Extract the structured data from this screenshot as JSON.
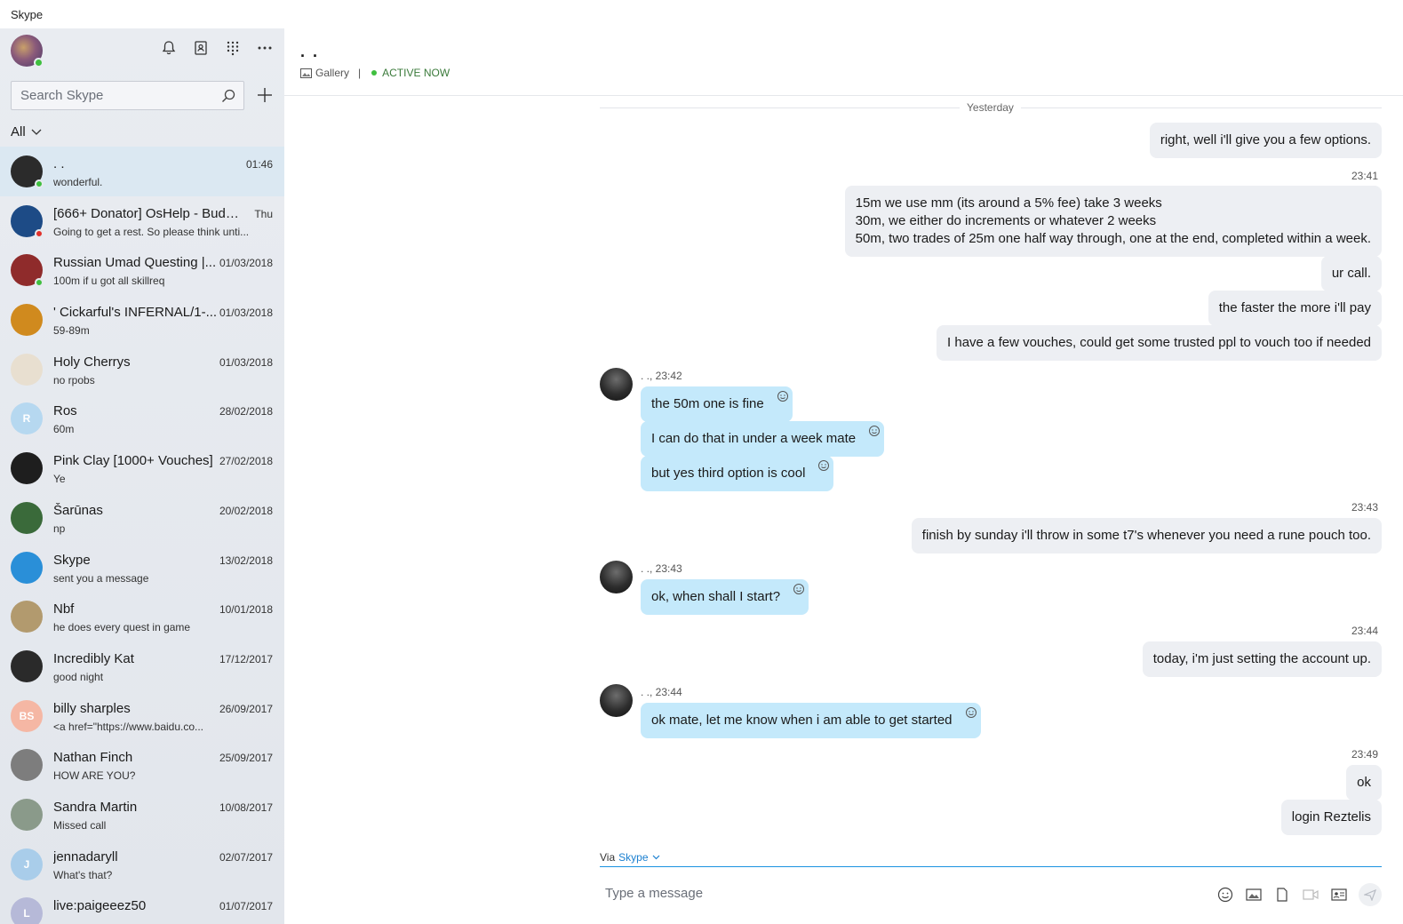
{
  "window": {
    "title": "Skype"
  },
  "sidebar": {
    "search_placeholder": "Search Skype",
    "filter_label": "All",
    "conversations": [
      {
        "name": ". .",
        "time": "01:46",
        "preview": "wonderful.",
        "avatar_color": "#2b2b2b",
        "initials": "",
        "presence": "#3fbf3f"
      },
      {
        "name": "[666+ Donator] OsHelp - Budd...",
        "time": "Thu",
        "preview": "Going to get a rest. So please think unti...",
        "avatar_color": "#1d4b86",
        "initials": "",
        "presence": "#e0312b"
      },
      {
        "name": "Russian Umad Questing |...",
        "time": "01/03/2018",
        "preview": "100m if u got all skillreq",
        "avatar_color": "#8f2b2b",
        "initials": "",
        "presence": "#3fbf3f"
      },
      {
        "name": "' Cickarful's INFERNAL/1-...",
        "time": "01/03/2018",
        "preview": "59-89m",
        "avatar_color": "#d08a1e",
        "initials": "",
        "presence": ""
      },
      {
        "name": "Holy Cherrys",
        "time": "01/03/2018",
        "preview": "no rpobs",
        "avatar_color": "#e8dfd0",
        "initials": "",
        "presence": ""
      },
      {
        "name": "Ros",
        "time": "28/02/2018",
        "preview": "60m",
        "avatar_color": "#b6d8f0",
        "initials": "R",
        "presence": ""
      },
      {
        "name": "Pink Clay [1000+ Vouches]",
        "time": "27/02/2018",
        "preview": "Ye",
        "avatar_color": "#1e1e1e",
        "initials": "",
        "presence": ""
      },
      {
        "name": "Šarūnas",
        "time": "20/02/2018",
        "preview": "np",
        "avatar_color": "#3a6a3a",
        "initials": "",
        "presence": ""
      },
      {
        "name": "Skype",
        "time": "13/02/2018",
        "preview": "sent you a message",
        "avatar_color": "#2a8fd8",
        "initials": "",
        "presence": ""
      },
      {
        "name": "Nbf",
        "time": "10/01/2018",
        "preview": "he does every quest in game",
        "avatar_color": "#b29a6e",
        "initials": "",
        "presence": ""
      },
      {
        "name": "Incredibly Kat",
        "time": "17/12/2017",
        "preview": "good night",
        "avatar_color": "#2a2a2a",
        "initials": "",
        "presence": ""
      },
      {
        "name": "billy sharples",
        "time": "26/09/2017",
        "preview": "<a href=\"https://www.baidu.co...",
        "avatar_color": "#f5b7a4",
        "initials": "BS",
        "presence": ""
      },
      {
        "name": "Nathan Finch",
        "time": "25/09/2017",
        "preview": "HOW ARE YOU?",
        "avatar_color": "#7d7d7d",
        "initials": "",
        "presence": ""
      },
      {
        "name": "Sandra Martin",
        "time": "10/08/2017",
        "preview": "Missed call",
        "avatar_color": "#8a9a8a",
        "initials": "",
        "presence": ""
      },
      {
        "name": "jennadaryll",
        "time": "02/07/2017",
        "preview": "What's that?",
        "avatar_color": "#a9cdea",
        "initials": "J",
        "presence": ""
      },
      {
        "name": "live:paigeeez50",
        "time": "01/07/2017",
        "preview": "",
        "avatar_color": "#b6b9d8",
        "initials": "L",
        "presence": ""
      }
    ]
  },
  "chat": {
    "title": ". .",
    "gallery_label": "Gallery",
    "separator": "|",
    "status": "ACTIVE NOW",
    "day_divider": "Yesterday",
    "outgoing": [
      {
        "text": "right, well i'll give you a few options."
      },
      {
        "time": "23:41",
        "lines": [
          "15m we use mm (its around a 5% fee) take 3 weeks",
          "30m, we either do increments or whatever 2 weeks",
          "50m, two trades of 25m one half way through, one at the end, completed within a week."
        ]
      },
      {
        "text": "ur call."
      },
      {
        "text": "the faster the more i'll pay"
      },
      {
        "text": "I have a few vouches, could get some trusted ppl to vouch too if needed"
      },
      {
        "time": "23:43",
        "text": "finish by sunday i'll throw in some t7's whenever you need a rune pouch too."
      },
      {
        "time": "23:44",
        "text": "today, i'm just setting the account up."
      },
      {
        "time": "23:49",
        "text": "ok"
      },
      {
        "text": "login Reztelis"
      }
    ],
    "incoming": [
      {
        "meta": ". ., 23:42",
        "messages": [
          "the 50m one is fine",
          "I can do that in under a week mate",
          "but yes third option is cool"
        ]
      },
      {
        "meta": ". ., 23:43",
        "messages": [
          "ok, when shall I start?"
        ]
      },
      {
        "meta": ". ., 23:44",
        "messages": [
          "ok mate, let me know when i am able to get started"
        ]
      }
    ]
  },
  "compose": {
    "via_label": "Via",
    "via_service": "Skype",
    "placeholder": "Type a message"
  }
}
